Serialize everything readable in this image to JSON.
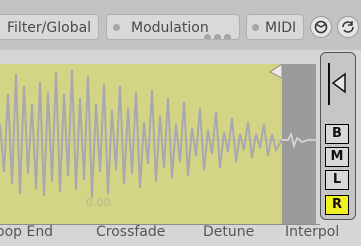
{
  "tabs": {
    "filter_global": "Filter/Global",
    "modulation": "Modulation",
    "midi": "MIDI"
  },
  "waveform_side": {
    "buttons": [
      "B",
      "M",
      "L",
      "R"
    ],
    "active": "R"
  },
  "parameters": {
    "loop_end": "oop End",
    "crossfade": "Crossfade",
    "detune": "Detune",
    "interpol": "Interpol"
  },
  "overlay_text": "0.00",
  "colors": {
    "waveform_background": "#d4d584",
    "waveform_line": "#a8a8b0",
    "active_button": "#f1f224"
  }
}
